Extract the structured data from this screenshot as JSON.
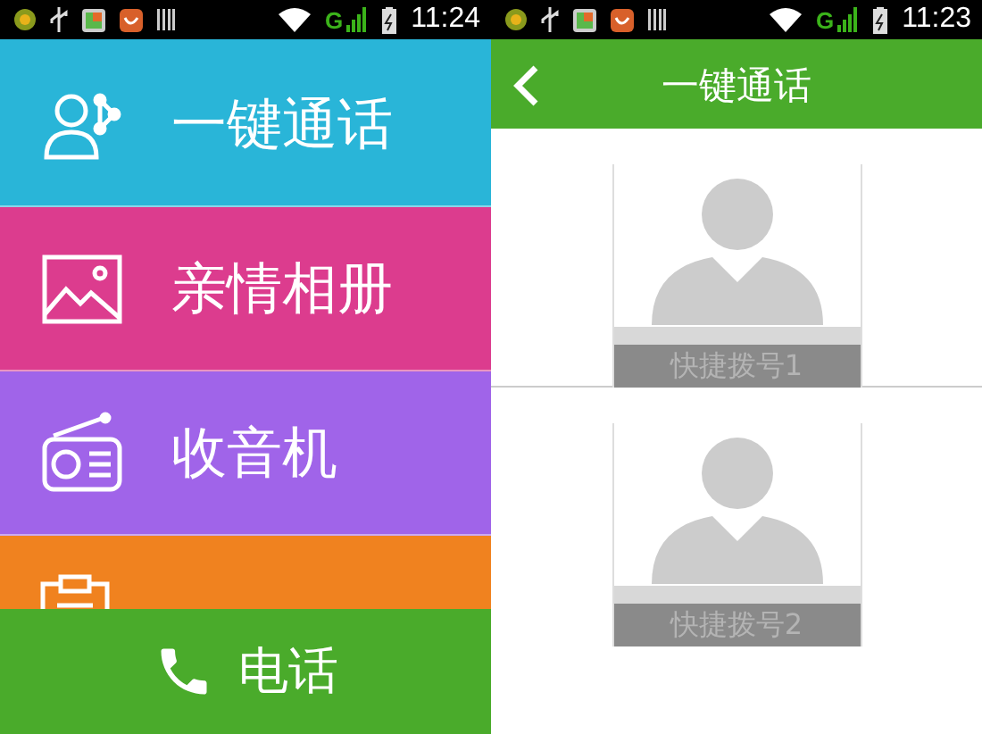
{
  "status_bars": [
    {
      "network": "G",
      "time": "11:24"
    },
    {
      "network": "G",
      "time": "11:23"
    }
  ],
  "menu": {
    "items": [
      {
        "kind": "contacts",
        "label": "一键通话",
        "color": "#29b5d8"
      },
      {
        "kind": "album",
        "label": "亲情相册",
        "color": "#dc3c8e"
      },
      {
        "kind": "radio",
        "label": "收音机",
        "color": "#a064e9"
      },
      {
        "kind": "clipboard",
        "color": "#f0821f"
      }
    ]
  },
  "bottom_bar": {
    "label": "电话"
  },
  "detail": {
    "title": "一键通话",
    "speed_dials": [
      {
        "label": "快捷拨号1"
      },
      {
        "label": "快捷拨号2"
      }
    ]
  }
}
